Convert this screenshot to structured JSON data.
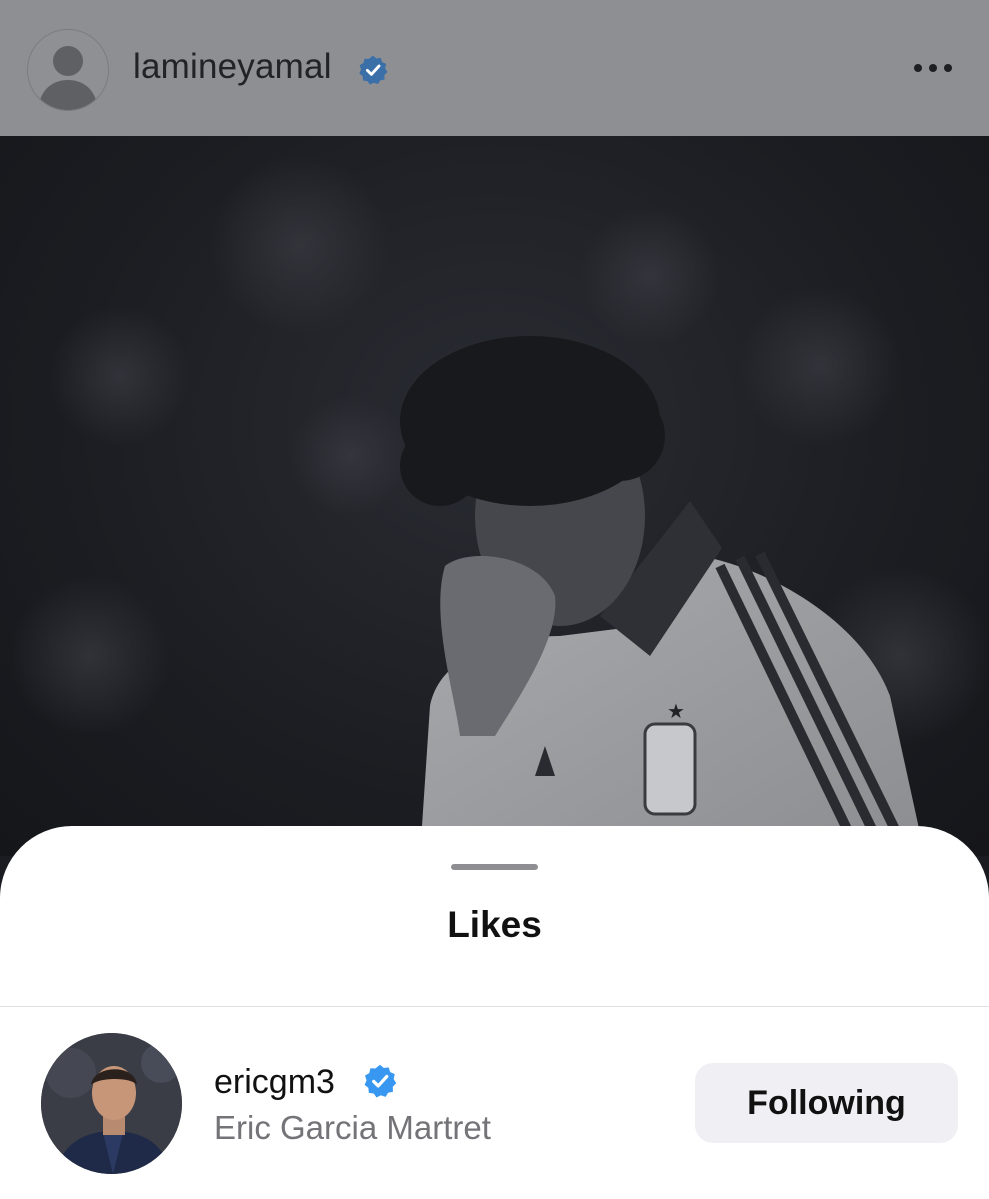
{
  "post": {
    "username": "lamineyamal",
    "verified": true,
    "more_icon": "more-horizontal-icon"
  },
  "photo": {
    "description_icon": "post-photo",
    "crest_star": "★"
  },
  "likes_sheet": {
    "title": "Likes",
    "users": [
      {
        "username": "ericgm3",
        "full_name": "Eric Garcia Martret",
        "verified": true,
        "button_label": "Following"
      }
    ]
  },
  "colors": {
    "verified_blue": "#3897f0",
    "header_bg": "#8e8f92",
    "sheet_bg": "#ffffff",
    "button_bg": "#efeff4"
  }
}
